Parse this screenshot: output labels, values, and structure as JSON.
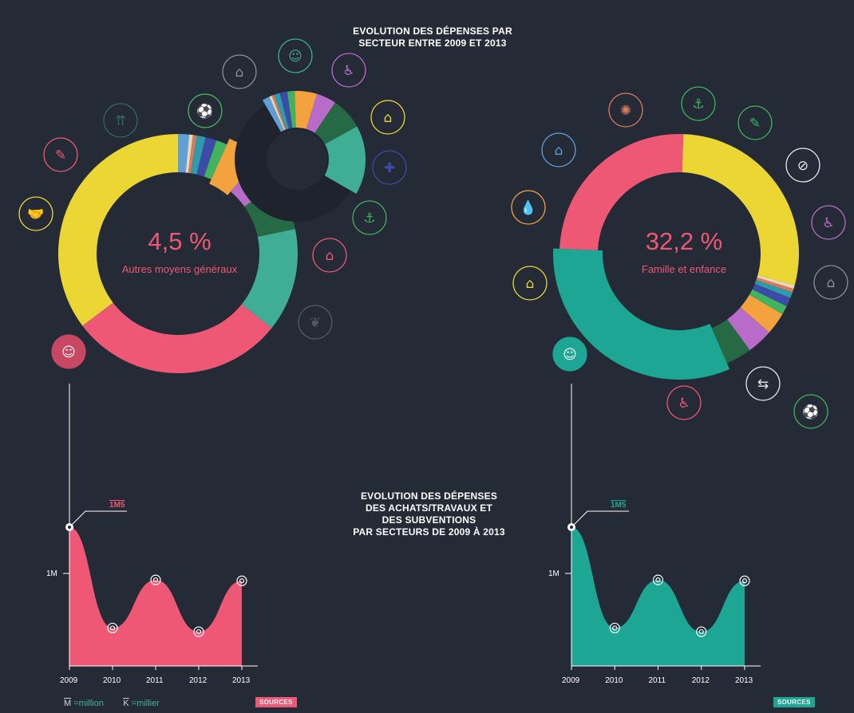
{
  "titles": {
    "top": [
      "EVOLUTION DES DÉPENSES PAR",
      "SECTEUR ENTRE 2009 ET 2013"
    ],
    "middle": [
      "EVOLUTION DES DÉPENSES",
      "DES ACHATS/TRAVAUX ET",
      "DES SUBVENTIONS",
      "PAR SECTEURS DE 2009 À 2013"
    ]
  },
  "chart_data": [
    {
      "type": "pie",
      "variant": "donut",
      "center_value": "4,5 %",
      "center_label": "Autres moyens généraux",
      "slices": [
        {
          "value": 1.5,
          "color": "#5fa0d8"
        },
        {
          "value": 0.5,
          "color": "#e9d7b5"
        },
        {
          "value": 0.5,
          "color": "#d77a5f"
        },
        {
          "value": 1.2,
          "color": "#2e9ca8"
        },
        {
          "value": 1.5,
          "color": "#3d4ba8"
        },
        {
          "value": 1.5,
          "color": "#3fb35d"
        },
        {
          "value": 4.5,
          "color": "#f3a23d",
          "highlighted": true
        },
        {
          "value": 4.0,
          "color": "#b86cc7"
        },
        {
          "value": 6.5,
          "color": "#256a44"
        },
        {
          "value": 14.0,
          "color": "#3fae94"
        },
        {
          "value": 29.0,
          "color": "#ee5874"
        },
        {
          "value": 35.3,
          "color": "#ecd633"
        }
      ],
      "icons": [
        "handshake-icon",
        "pencil-icon",
        "road-icon",
        "football-icon",
        "house-city-icon",
        "family-icon",
        "wheelchair-icon",
        "house-icon",
        "bandage-icon",
        "anchor-icon",
        "house-wifi-icon",
        "leaf-icon",
        "people-group-icon"
      ]
    },
    {
      "type": "pie",
      "variant": "donut",
      "center_value": "32,2 %",
      "center_label": "Famille et enfance",
      "slices": [
        {
          "value": 28.7,
          "color": "#ecd633"
        },
        {
          "value": 0.5,
          "color": "#e9d7b5"
        },
        {
          "value": 0.5,
          "color": "#d77a5f"
        },
        {
          "value": 0.8,
          "color": "#2e9ca8"
        },
        {
          "value": 1.2,
          "color": "#3d4ba8"
        },
        {
          "value": 1.2,
          "color": "#3fb35d"
        },
        {
          "value": 3.0,
          "color": "#f3a23d"
        },
        {
          "value": 3.5,
          "color": "#b86cc7"
        },
        {
          "value": 3.5,
          "color": "#256a44"
        },
        {
          "value": 32.2,
          "color": "#1ea694",
          "highlighted": true
        },
        {
          "value": 24.9,
          "color": "#ee5874"
        }
      ],
      "icons": [
        "mandala-icon",
        "anchor-icon",
        "book-icon",
        "no-entry-icon",
        "wheelchair-icon",
        "house-city-icon",
        "football-icon",
        "directions-icon",
        "elderly-icon",
        "house-icon",
        "water-drop-icon",
        "houses-icon"
      ]
    },
    {
      "type": "area",
      "color": "#ee5874",
      "x": [
        2009,
        2010,
        2011,
        2012,
        2013
      ],
      "y": [
        1.5,
        0.41,
        0.93,
        0.37,
        0.92
      ],
      "unit": "M",
      "ymark": "1M",
      "peak_label": "1M5",
      "x_tick_labels": [
        "2009",
        "2010",
        "2011",
        "2012",
        "2013"
      ]
    },
    {
      "type": "area",
      "color": "#1ea694",
      "x": [
        2009,
        2010,
        2011,
        2012,
        2013
      ],
      "y": [
        1.5,
        0.41,
        0.93,
        0.37,
        0.92
      ],
      "unit": "M",
      "ymark": "1M",
      "peak_label": "1M5",
      "x_tick_labels": [
        "2009",
        "2010",
        "2011",
        "2012",
        "2013"
      ]
    }
  ],
  "legend": {
    "m_symbol": "M",
    "m_text": "=million",
    "k_symbol": "K",
    "k_text": "=millier"
  },
  "sources_label": "SOURCES",
  "colors": {
    "background": "#242a36",
    "pink": "#ee5874",
    "teal": "#1ea694"
  }
}
